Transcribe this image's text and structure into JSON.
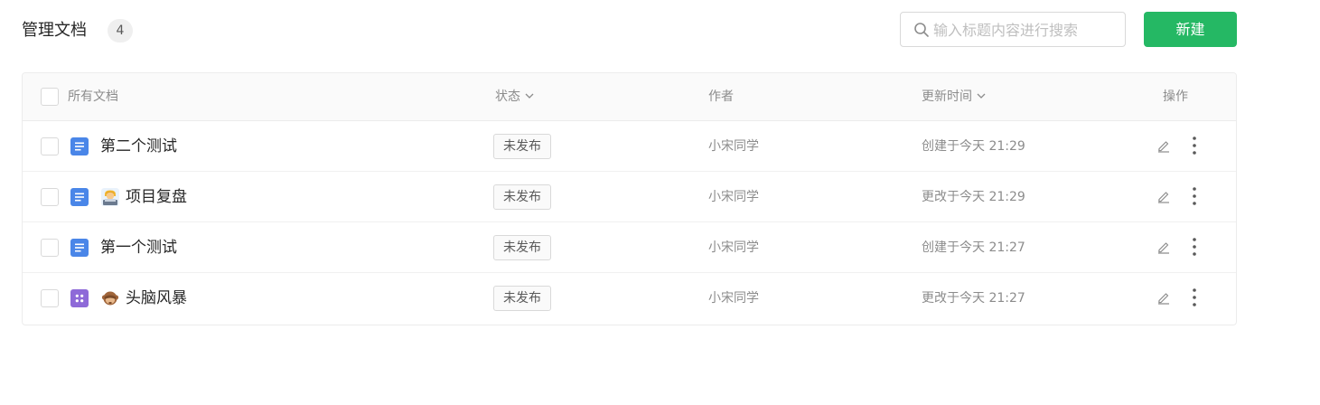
{
  "header": {
    "title": "管理文档",
    "count": "4",
    "search_placeholder": "输入标题内容进行搜索",
    "new_button_label": "新建"
  },
  "table": {
    "columns": {
      "name": "所有文档",
      "status": "状态",
      "author": "作者",
      "updated": "更新时间",
      "actions": "操作"
    },
    "rows": [
      {
        "doc_type": "doc",
        "emoji": "",
        "title": "第二个测试",
        "status": "未发布",
        "author": "小宋同学",
        "updated": "创建于今天 21:29"
      },
      {
        "doc_type": "doc",
        "emoji": "technologist-emoji",
        "title": "项目复盘",
        "status": "未发布",
        "author": "小宋同学",
        "updated": "更改于今天 21:29"
      },
      {
        "doc_type": "doc",
        "emoji": "",
        "title": "第一个测试",
        "status": "未发布",
        "author": "小宋同学",
        "updated": "创建于今天 21:27"
      },
      {
        "doc_type": "board",
        "emoji": "see-no-evil-monkey-emoji",
        "title": "头脑风暴",
        "status": "未发布",
        "author": "小宋同学",
        "updated": "更改于今天 21:27"
      }
    ]
  },
  "colors": {
    "accent": "#25b864",
    "doc_icon": "#4a86e8",
    "board_icon": "#8e6ad8"
  },
  "icons": {
    "search": "search-icon",
    "chevron": "chevron-down-icon",
    "edit": "pencil-icon",
    "more": "more-vertical-icon",
    "doc": "document-icon",
    "board": "board-icon"
  }
}
